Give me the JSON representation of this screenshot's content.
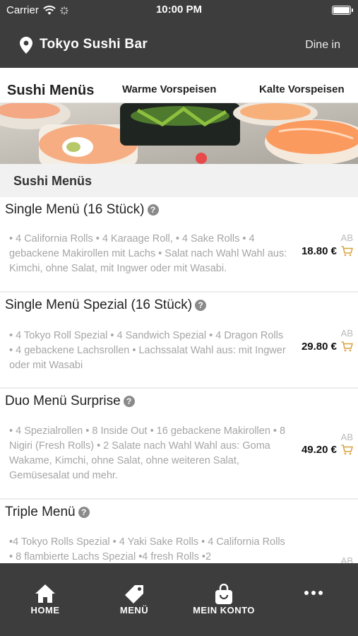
{
  "status": {
    "carrier": "Carrier",
    "time": "10:00 PM"
  },
  "header": {
    "restaurant": "Tokyo Sushi Bar",
    "mode": "Dine in"
  },
  "tabs": [
    "Sushi Menüs",
    "Warme Vorspeisen",
    "Kalte Vorspeisen"
  ],
  "section": {
    "title": "Sushi Menüs"
  },
  "accent": "#d9a13a",
  "items": [
    {
      "name": "Single Menü (16 Stück)",
      "desc": "• 4 California Rolls • 4 Karaage Roll, • 4 Sake Rolls • 4 gebackene Makirollen mit Lachs • Salat nach Wahl Wahl aus: Kimchi, ohne Salat, mit Ingwer oder mit Wasabi.",
      "ab": "AB",
      "price": "18.80 €"
    },
    {
      "name": "Single Menü Spezial (16 Stück)",
      "desc": "• 4 Tokyo Roll Spezial • 4 Sandwich Spezial • 4 Dragon Rolls • 4 gebackene Lachsrollen • Lachssalat Wahl aus: mit Ingwer oder mit Wasabi",
      "ab": "AB",
      "price": "29.80 €"
    },
    {
      "name": "Duo Menü Surprise",
      "desc": "• 4 Spezialrollen • 8 Inside Out • 16 gebackene Makirollen • 8 Nigiri (Fresh Rolls) • 2 Salate nach Wahl Wahl aus: Goma Wakame, Kimchi, ohne Salat, ohne weiteren Salat, Gemüsesalat und mehr.",
      "ab": "AB",
      "price": "49.20 €"
    },
    {
      "name": "Triple Menü",
      "desc": "•4 Tokyo Rolls Spezial • 4 Yaki Sake Rolls • 4 California Rolls • 8 flambierte Lachs Spezial •4 fresh Rolls •2",
      "ab": "AB",
      "price": ""
    }
  ],
  "bottom_nav": [
    {
      "label": "HOME",
      "icon": "home-icon"
    },
    {
      "label": "MENÜ",
      "icon": "tag-icon"
    },
    {
      "label": "MEIN KONTO",
      "icon": "shopping-bag-icon"
    },
    {
      "label": "",
      "icon": "more-icon"
    }
  ]
}
